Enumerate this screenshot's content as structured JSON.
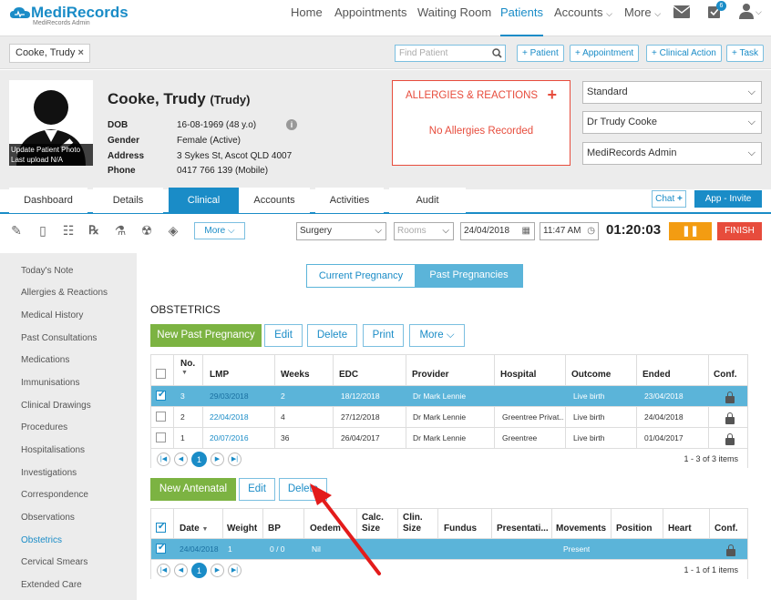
{
  "app": {
    "logo": "MediRecords",
    "logo_sub": "MediRecords Admin"
  },
  "nav": {
    "items": [
      "Home",
      "Appointments",
      "Waiting Room",
      "Patients",
      "Accounts",
      "More"
    ],
    "active": "Patients",
    "tasks_badge": "6"
  },
  "patient_bar": {
    "tag": "Cooke, Trudy",
    "find_placeholder": "Find Patient",
    "actions": [
      "+ Patient",
      "+ Appointment",
      "+ Clinical Action",
      "+ Task"
    ]
  },
  "patient": {
    "surname_given": "Cooke, Trudy",
    "preferred": "(Trudy)",
    "photo_caption_1": "Update Patient Photo",
    "photo_caption_2": "Last upload N/A",
    "details": [
      {
        "label": "DOB",
        "value": "16-08-1969 (48 y.o)"
      },
      {
        "label": "Gender",
        "value": "Female (Active)"
      },
      {
        "label": "Address",
        "value": "3 Sykes St, Ascot QLD 4007"
      },
      {
        "label": "Phone",
        "value": "0417 766 139 (Mobile)"
      }
    ]
  },
  "allergies": {
    "title": "ALLERGIES & REACTIONS",
    "empty": "No Allergies Recorded"
  },
  "selects": [
    "Standard",
    "Dr Trudy Cooke",
    "MediRecords Admin"
  ],
  "tabs": [
    "Dashboard",
    "Details",
    "Clinical",
    "Accounts",
    "Activities",
    "Audit"
  ],
  "active_tab": "Clinical",
  "chat_label": "Chat",
  "app_invite_label": "App - Invite",
  "toolbar": {
    "more_label": "More",
    "location": "Surgery",
    "rooms_placeholder": "Rooms",
    "date": "24/04/2018",
    "time": "11:47 AM",
    "timer": "01:20:03",
    "finish_label": "FINISH"
  },
  "sidebar": [
    "Today's Note",
    "Allergies & Reactions",
    "Medical History",
    "Past Consultations",
    "Medications",
    "Immunisations",
    "Clinical Drawings",
    "Procedures",
    "Hospitalisations",
    "Investigations",
    "Correspondence",
    "Observations",
    "Obstetrics",
    "Cervical Smears",
    "Extended Care"
  ],
  "sidebar_active": "Obstetrics",
  "segment": {
    "current": "Current Pregnancy",
    "past": "Past Pregnancies"
  },
  "section_title": "OBSTETRICS",
  "past_buttons": {
    "new": "New Past Pregnancy",
    "edit": "Edit",
    "delete": "Delete",
    "print": "Print",
    "more": "More"
  },
  "past_grid": {
    "headers": [
      "No.",
      "LMP",
      "Weeks",
      "EDC",
      "Provider",
      "Hospital",
      "Outcome",
      "Ended",
      "Conf."
    ],
    "rows": [
      {
        "no": "3",
        "lmp": "29/03/2018",
        "weeks": "2",
        "edc": "18/12/2018",
        "provider": "Dr Mark Lennie",
        "hospital": "",
        "outcome": "Live birth",
        "ended": "23/04/2018",
        "checked": true
      },
      {
        "no": "2",
        "lmp": "22/04/2018",
        "weeks": "4",
        "edc": "27/12/2018",
        "provider": "Dr Mark Lennie",
        "hospital": "Greentree Privat...",
        "outcome": "Live birth",
        "ended": "24/04/2018",
        "checked": false
      },
      {
        "no": "1",
        "lmp": "20/07/2016",
        "weeks": "36",
        "edc": "26/04/2017",
        "provider": "Dr Mark Lennie",
        "hospital": "Greentree",
        "outcome": "Live birth",
        "ended": "01/04/2017",
        "checked": false
      }
    ],
    "page": "1",
    "info": "1 - 3 of 3 items"
  },
  "antenatal_buttons": {
    "new": "New Antenatal",
    "edit": "Edit",
    "delete": "Delete"
  },
  "antenatal_grid": {
    "headers": [
      "Date",
      "Weight",
      "BP",
      "Oedem",
      "Calc.",
      "Size",
      "Clin.",
      "Size",
      "Fundus",
      "Presentati...",
      "Movements",
      "Position",
      "Heart",
      "Conf."
    ],
    "rows": [
      {
        "date": "24/04/2018",
        "weight": "1",
        "bp": "0 / 0",
        "oedema": "Nil",
        "movements": "Present",
        "checked": true
      }
    ],
    "page": "1",
    "info": "1 - 1 of 1 items"
  },
  "colors": {
    "brand": "#1a8cc7",
    "green": "#7cb342",
    "alert": "#e74c3c",
    "pause": "#f39c12",
    "selected_row": "#5bb4d9"
  }
}
